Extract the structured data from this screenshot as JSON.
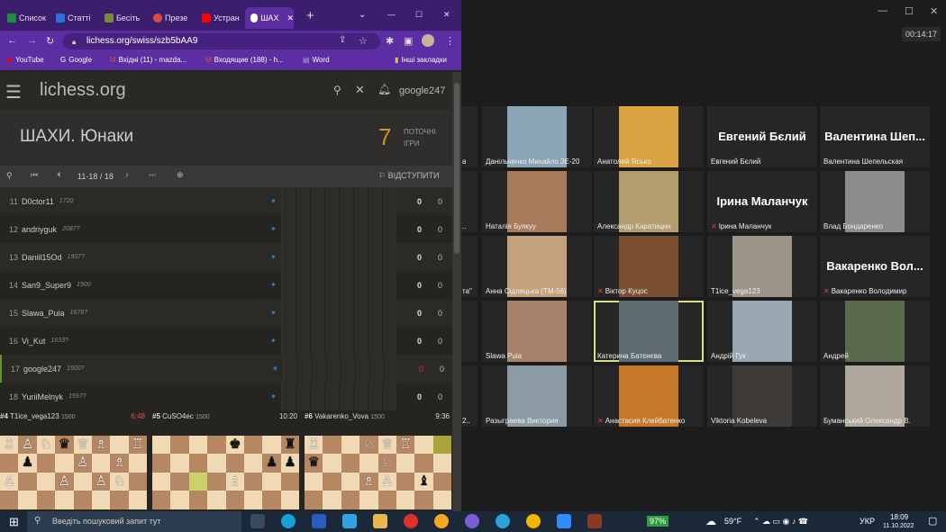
{
  "zoom": {
    "timer": "00:14:17",
    "tiles": [
      {
        "name": "Данільченко Михайло 3Е-20",
        "big": "",
        "color": "#8aa3b5",
        "muted": false
      },
      {
        "name": "Анатолий Ясько",
        "big": "",
        "color": "#d9a441",
        "muted": false
      },
      {
        "name": "Евгений Бєлий",
        "big": "Евгений Бєлий",
        "color": "",
        "muted": false
      },
      {
        "name": "Валентина Шепельская",
        "big": "Валентина Шеп...",
        "color": "",
        "muted": false
      },
      {
        "name": "Наталія Буякуу",
        "big": "",
        "color": "#a87a5a",
        "muted": false
      },
      {
        "name": "Александр Каратицин",
        "big": "",
        "color": "#b49d6e",
        "muted": false
      },
      {
        "name": "Ірина Маланчук",
        "big": "Ірина Маланчук",
        "color": "",
        "muted": true
      },
      {
        "name": "Влад Бондаренко",
        "big": "",
        "color": "#8c8c8c",
        "muted": false
      },
      {
        "name": "Анна Сідлецька (ТМ-56)",
        "big": "",
        "color": "#c5a27e",
        "muted": false
      },
      {
        "name": "Віктор Куцос",
        "big": "",
        "color": "#7a4e2e",
        "muted": true
      },
      {
        "name": "T1ice_vega123",
        "big": "",
        "color": "#9c9389",
        "muted": false
      },
      {
        "name": "Вакаренко Володимир",
        "big": "Вакаренко Вол...",
        "color": "",
        "muted": true
      },
      {
        "name": "Slawa Puia",
        "big": "",
        "color": "#a7826a",
        "muted": false
      },
      {
        "name": "Катерина Батєнєва",
        "big": "",
        "color": "#5f6c74",
        "muted": false
      },
      {
        "name": "Андрій Гук",
        "big": "",
        "color": "#9ba7b0",
        "muted": false
      },
      {
        "name": "Андрей",
        "big": "",
        "color": "#5a6a4a",
        "muted": false
      },
      {
        "name": "Разыграева Виктория",
        "big": "",
        "color": "#8c9aa4",
        "muted": false
      },
      {
        "name": "Анастасия Клейбатенко",
        "big": "",
        "color": "#c8782a",
        "muted": true
      },
      {
        "name": "Viktoria Kobeleva",
        "big": "",
        "color": "#3d3a38",
        "muted": false
      },
      {
        "name": "Буманський Олександр В.",
        "big": "",
        "color": "#b0a89c",
        "muted": false
      }
    ],
    "left_fragments": [
      "а",
      "..",
      "та\"",
      "",
      "2.."
    ]
  },
  "chrome": {
    "tabs": [
      "Список",
      "Статті",
      "Бесіть",
      "Презе",
      "Устран",
      "ШАХ"
    ],
    "url": "lichess.org/swiss/szb5bAA9",
    "bookmarks": [
      "YouTube",
      "Google",
      "Вхідні (11) - mazda...",
      "Входящие (188) - h...",
      "Word",
      "Інші закладки"
    ]
  },
  "lichess": {
    "logo": "lichess.org",
    "user": "google247",
    "title": "ШАХИ. Юнаки",
    "games_count": "7",
    "games_label_1": "ПОТОЧНІ",
    "games_label_2": "ІГРИ",
    "page": "11-18 / 18",
    "withdraw": "ВІДСТУПИТИ",
    "players": [
      {
        "rank": "11",
        "name": "D0ctor11",
        "rating": "1720",
        "pts": "0",
        "tb": "0",
        "me": false
      },
      {
        "rank": "12",
        "name": "andriyguk",
        "rating": "2087?",
        "pts": "0",
        "tb": "0",
        "me": false
      },
      {
        "rank": "13",
        "name": "Daniil15Od",
        "rating": "1907?",
        "pts": "0",
        "tb": "0",
        "me": false
      },
      {
        "rank": "14",
        "name": "San9_Super9",
        "rating": "1900",
        "pts": "0",
        "tb": "0",
        "me": false
      },
      {
        "rank": "15",
        "name": "Slawa_Puia",
        "rating": "1678?",
        "pts": "0",
        "tb": "0",
        "me": false
      },
      {
        "rank": "16",
        "name": "Vi_Kut",
        "rating": "1633?",
        "pts": "0",
        "tb": "0",
        "me": false
      },
      {
        "rank": "17",
        "name": "google247",
        "rating": "1500?",
        "pts": "0",
        "tb": "0",
        "me": true
      },
      {
        "rank": "18",
        "name": "YuriiMelnyk",
        "rating": "1597?",
        "pts": "0",
        "tb": "0",
        "me": false
      }
    ],
    "games": [
      {
        "num": "#4",
        "player": "T1ice_vega123",
        "rating": "1500",
        "clock": "6:48",
        "clock_color": "#e05050"
      },
      {
        "num": "#5",
        "player": "CuSO4ec",
        "rating": "1500",
        "clock": "10:20",
        "clock_color": "#ddd"
      },
      {
        "num": "#6",
        "player": "Vakarenko_Vova",
        "rating": "1500",
        "clock": "9:36",
        "clock_color": "#ddd"
      }
    ]
  },
  "taskbar": {
    "search_placeholder": "Введіть пошуковий запит тут",
    "battery": "97%",
    "weather": "59°F",
    "lang": "УКР",
    "time": "18:09",
    "date": "11.10.2022"
  }
}
